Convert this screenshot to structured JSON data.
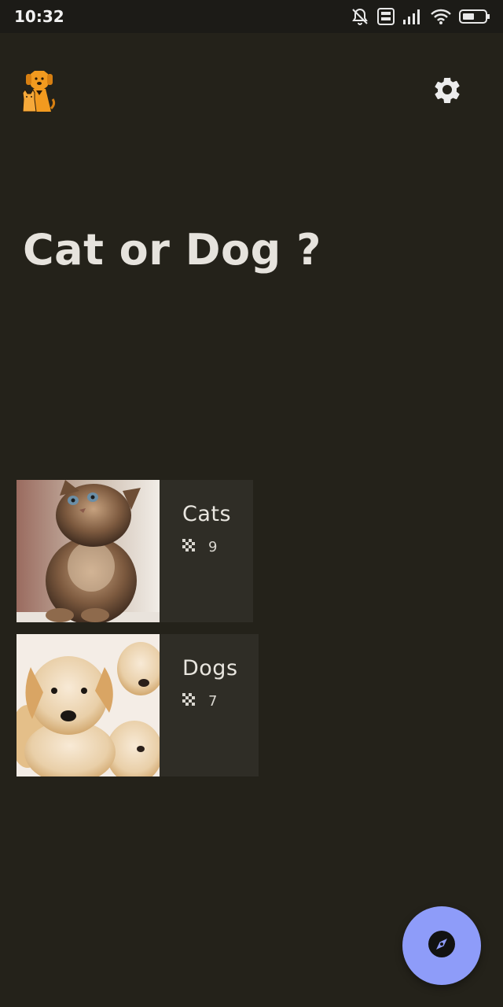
{
  "status_bar": {
    "time": "10:32",
    "icons": [
      "notifications-off-icon",
      "volte-icon",
      "signal-icon",
      "wifi-icon",
      "battery-icon"
    ]
  },
  "header": {
    "logo_icon": "cat-dog-logo-icon",
    "settings_icon": "gear-icon"
  },
  "title": "Cat or Dog ?",
  "categories": [
    {
      "label": "Cats",
      "count": "9",
      "image": "kitten-photo",
      "count_icon": "mosaic-icon"
    },
    {
      "label": "Dogs",
      "count": "7",
      "image": "puppies-photo",
      "count_icon": "mosaic-icon"
    }
  ],
  "fab": {
    "icon": "compass-icon",
    "color": "#8e9cf9"
  },
  "colors": {
    "background": "#24221a",
    "card": "#2f2d26",
    "logo": "#f29a1f"
  }
}
